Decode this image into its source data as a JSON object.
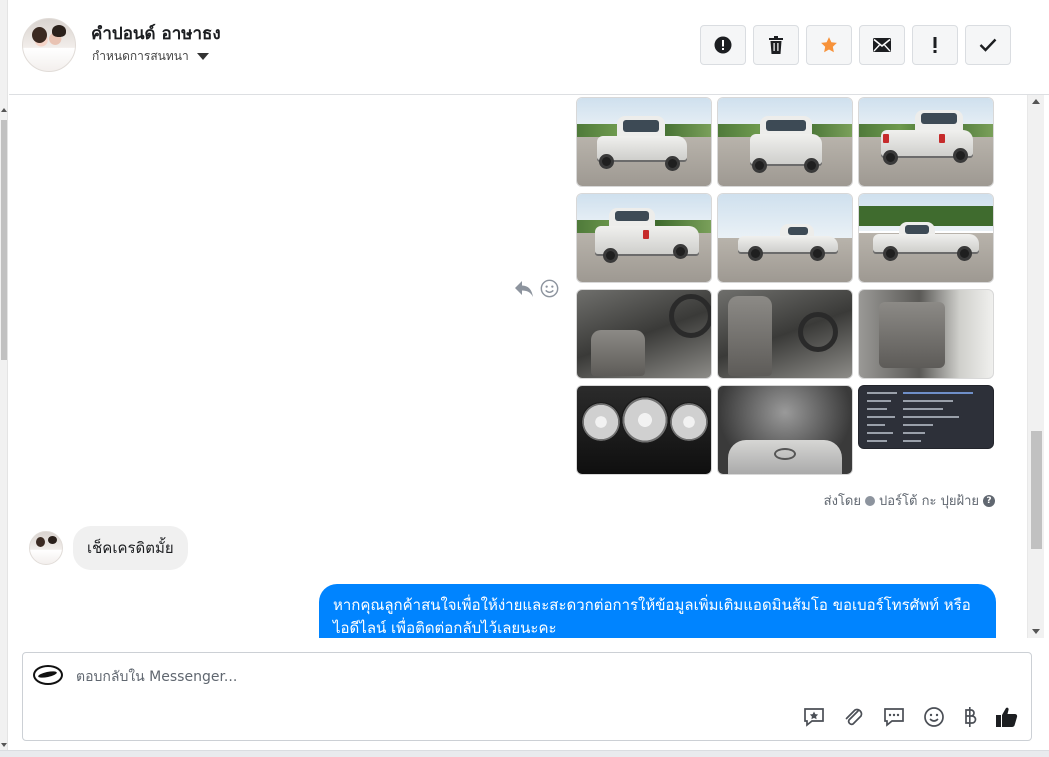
{
  "header": {
    "contact_name": "คำปอนด์ อาษาธง",
    "assign_label": "กำหนดการสนทนา",
    "toolbar": [
      {
        "name": "report-spam-button",
        "icon": "alert-circle-icon"
      },
      {
        "name": "delete-button",
        "icon": "trash-icon"
      },
      {
        "name": "star-button",
        "icon": "star-icon"
      },
      {
        "name": "mark-unread-button",
        "icon": "envelope-icon"
      },
      {
        "name": "follow-up-button",
        "icon": "exclamation-icon"
      },
      {
        "name": "done-button",
        "icon": "check-icon"
      }
    ]
  },
  "conversation": {
    "sent_by_label": "ส่งโดย",
    "sent_by_name": "ปอร์โต้ กะ ปุยฝ้าย",
    "incoming_message": "เช็คเครดิตมั้ย",
    "outgoing_message": "หากคุณลูกค้าสนใจเพื่อให้ง่ายและสะดวกต่อการให้ข้อมูลเพิ่มเติมแอดมินส้มโอ ขอเบอร์โทรศัพท์ หรือ ไอดีไลน์ เพื่อติดต่อกลับไว้เลยนะคะ"
  },
  "composer": {
    "placeholder": "ตอบกลับใน Messenger...",
    "tools": [
      "saved-reply-icon",
      "attachment-icon",
      "chat-bubble-icon",
      "emoji-icon",
      "baht-icon",
      "thumbs-up-icon"
    ]
  },
  "colors": {
    "accent": "#0084ff",
    "star": "#f7923a",
    "incoming_bubble": "#f0f0f0"
  }
}
